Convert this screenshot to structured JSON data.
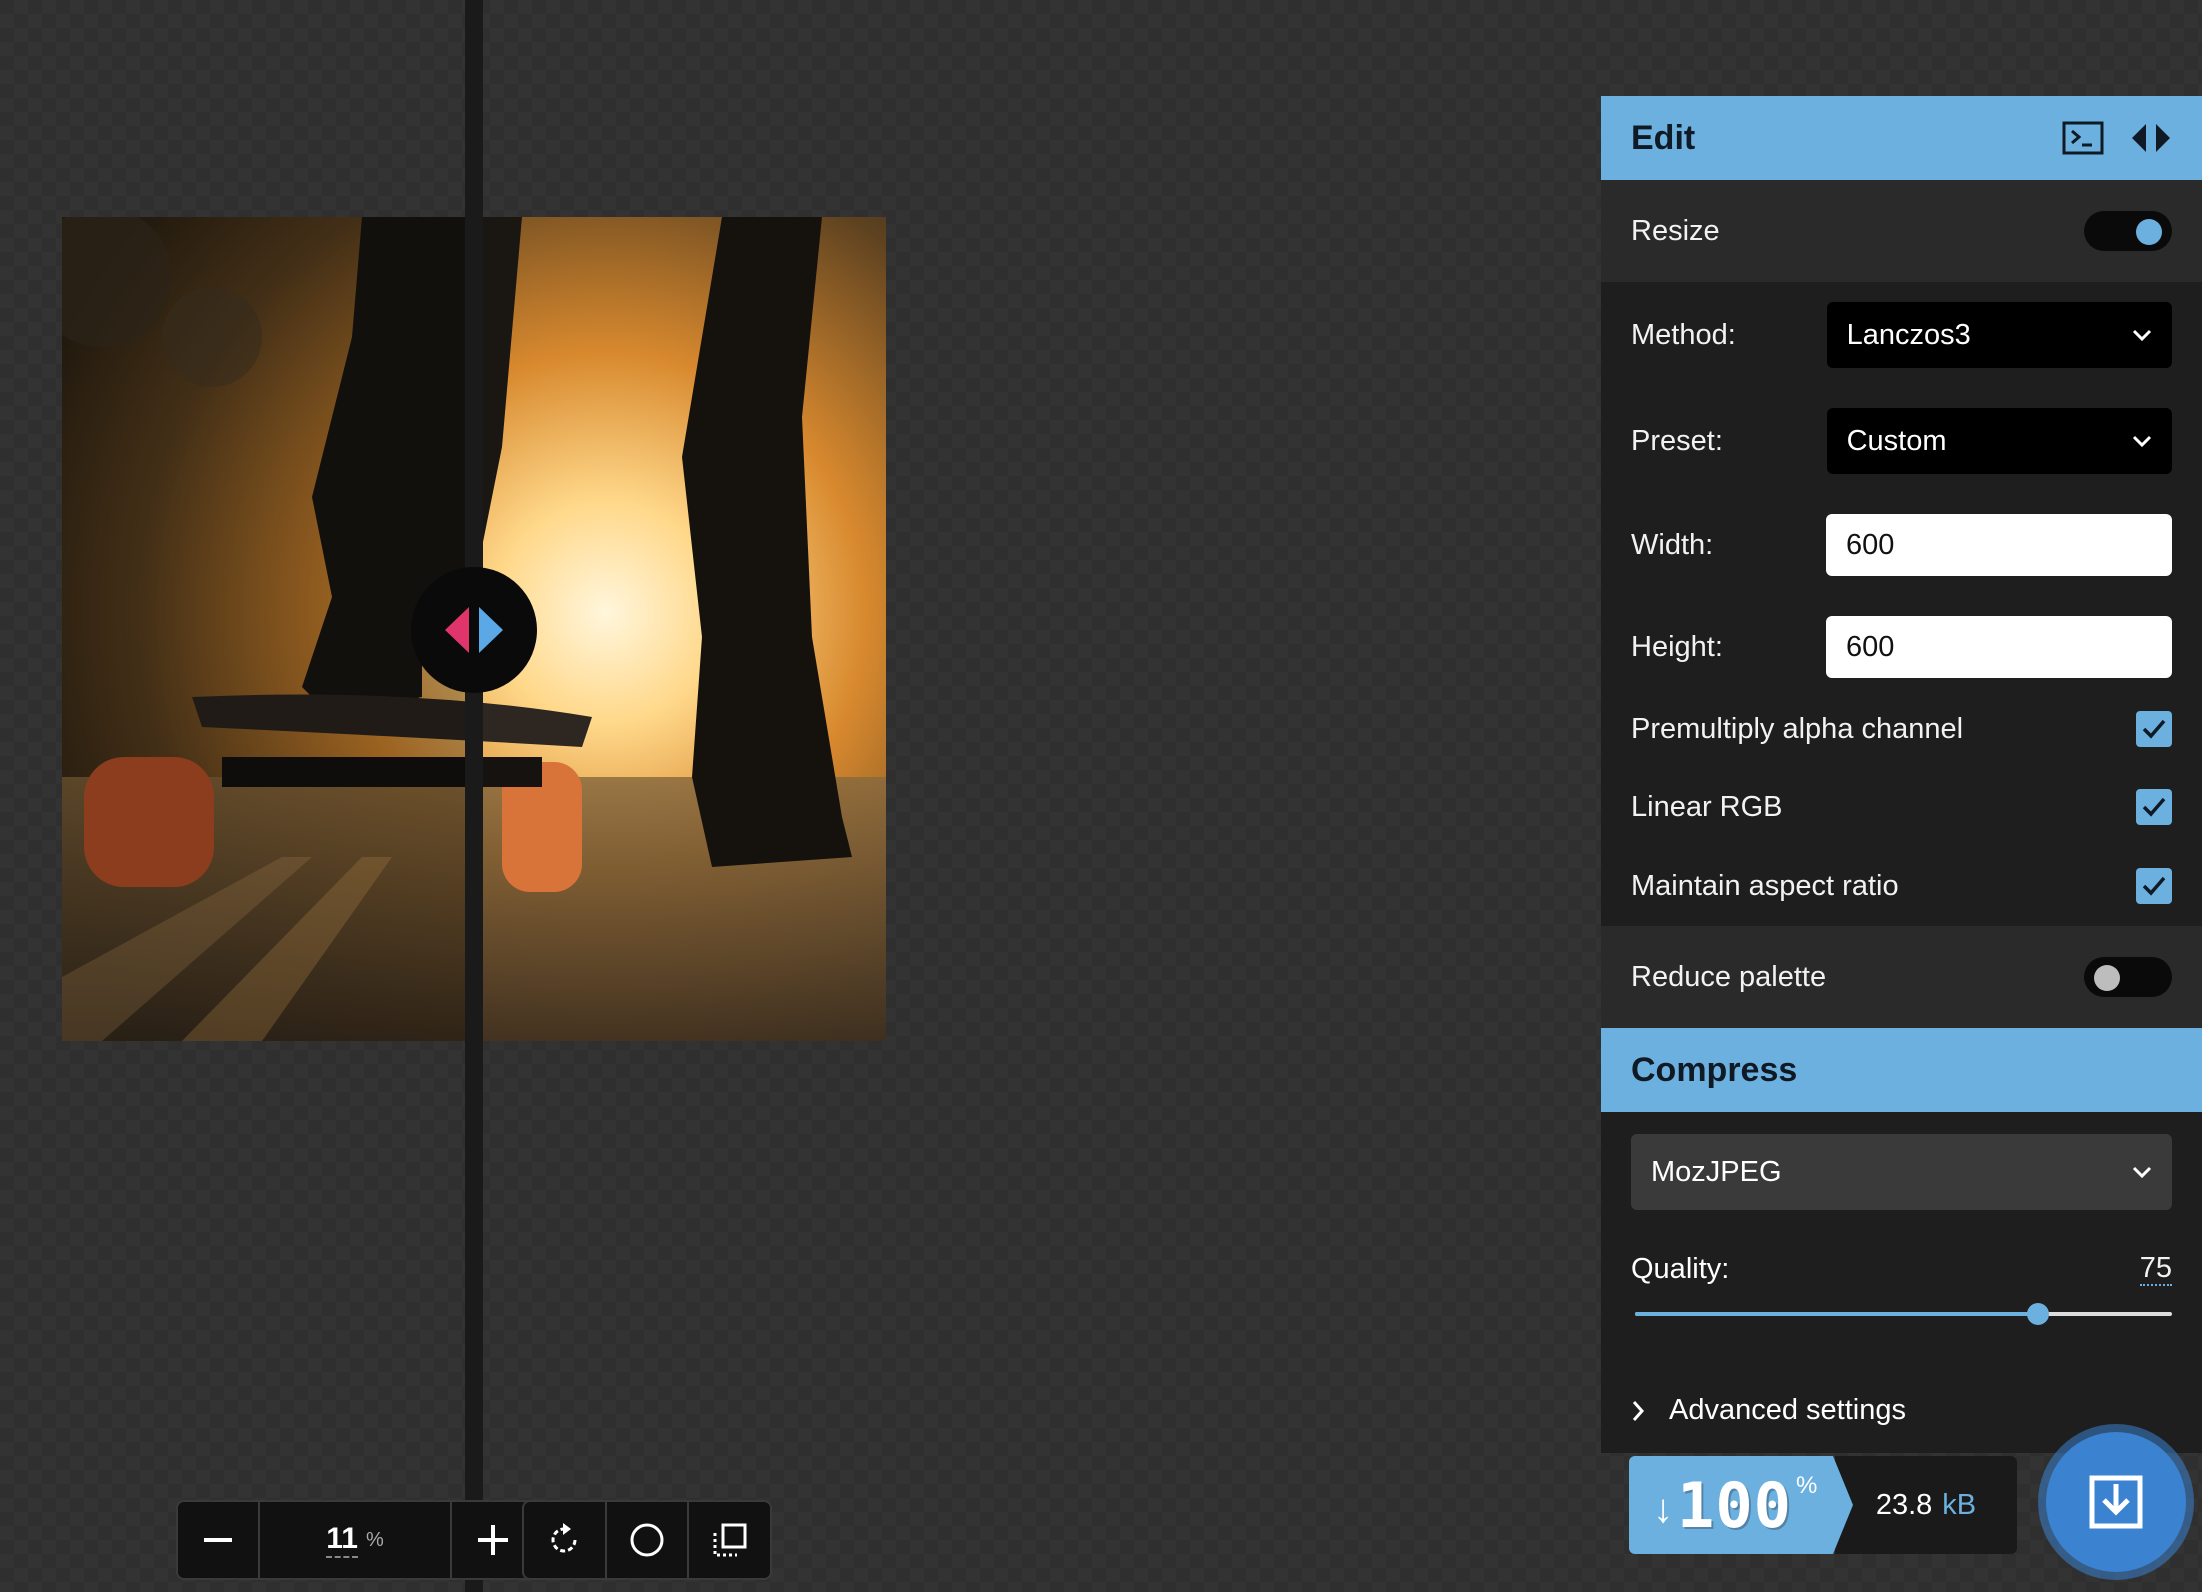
{
  "preview": {
    "image_alt": "skateboarder at sunset",
    "zoom_value": "11",
    "zoom_unit": "%"
  },
  "toolbar": {
    "zoom_out_icon": "minus-icon",
    "zoom_in_icon": "plus-icon",
    "rotate_icon": "rotate-icon",
    "background_icon": "circle-icon",
    "crop_icon": "crop-icon"
  },
  "edit": {
    "title": "Edit",
    "resize": {
      "label": "Resize",
      "enabled": true,
      "method_label": "Method:",
      "method_value": "Lanczos3",
      "preset_label": "Preset:",
      "preset_value": "Custom",
      "width_label": "Width:",
      "width_value": "600",
      "height_label": "Height:",
      "height_value": "600",
      "premultiply_label": "Premultiply alpha channel",
      "premultiply_checked": true,
      "linear_rgb_label": "Linear RGB",
      "linear_rgb_checked": true,
      "aspect_label": "Maintain aspect ratio",
      "aspect_checked": true
    },
    "reduce_palette": {
      "label": "Reduce palette",
      "enabled": false
    }
  },
  "compress": {
    "title": "Compress",
    "codec": "MozJPEG",
    "quality_label": "Quality:",
    "quality_value": "75",
    "quality_fraction": 0.75,
    "advanced_label": "Advanced settings"
  },
  "results": {
    "arrow": "↓",
    "savings": "100",
    "savings_unit": "%",
    "size_value": "23.8",
    "size_unit": "kB"
  },
  "colors": {
    "accent": "#6cb0e0",
    "handle_left": "#e0356b",
    "handle_right": "#5aa9e6"
  }
}
